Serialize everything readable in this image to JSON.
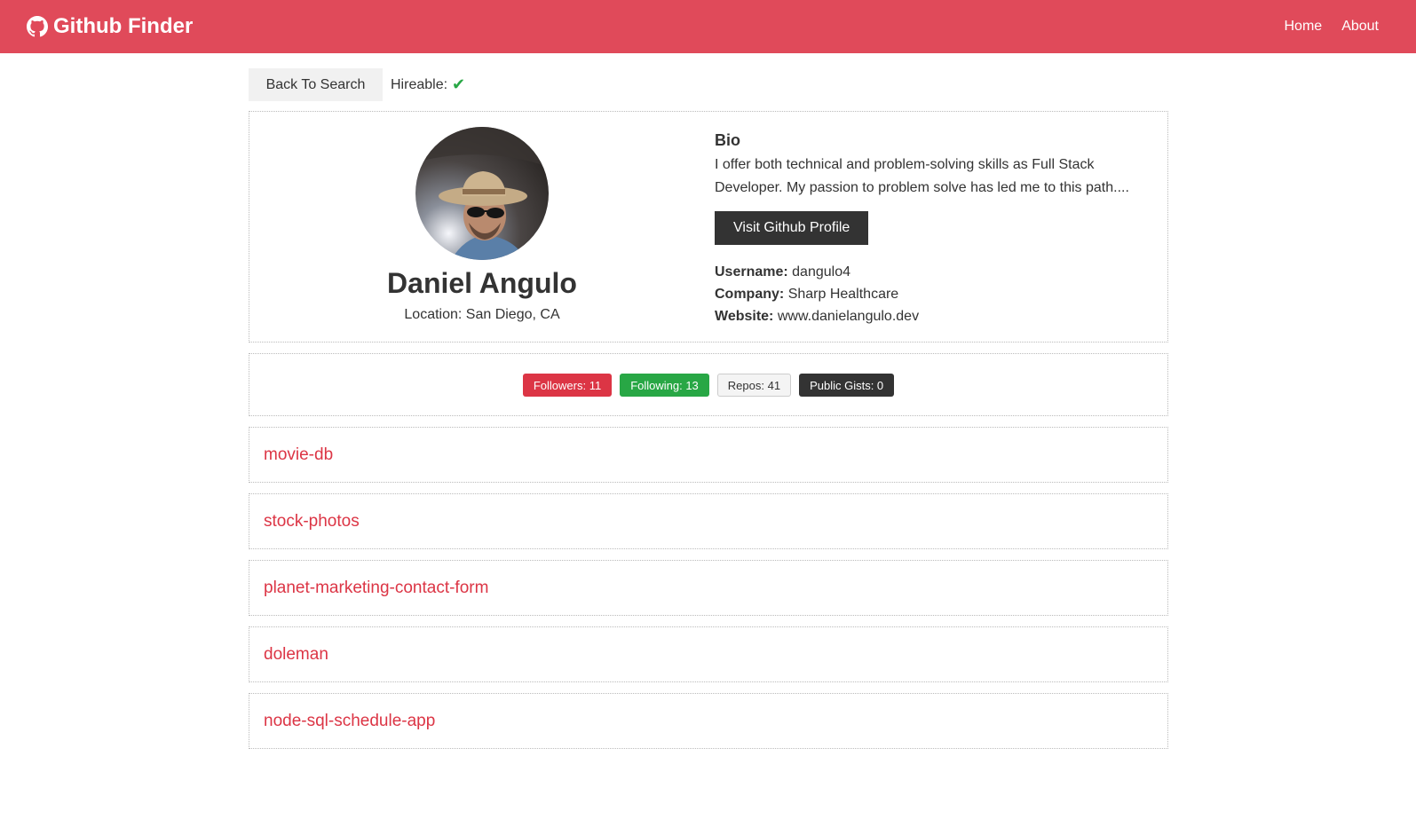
{
  "navbar": {
    "brand": "Github Finder",
    "brand_icon": "github-icon",
    "links": [
      "Home",
      "About"
    ],
    "color": "#e04a5a"
  },
  "topbar": {
    "back_label": "Back To Search",
    "hireable_label": "Hireable:",
    "hireable": true,
    "hireable_icon": "check-icon"
  },
  "profile": {
    "name": "Daniel Angulo",
    "location": "Location: San Diego, CA",
    "bio_heading": "Bio",
    "bio": "I offer both technical and problem-solving skills as Full Stack Developer. My passion to problem solve has led me to this path....",
    "visit_label": "Visit Github Profile",
    "username_label": "Username:",
    "username": "dangulo4",
    "company_label": "Company:",
    "company": "Sharp Healthcare",
    "website_label": "Website:",
    "website": "www.danielangulo.dev"
  },
  "stats": {
    "followers": "Followers: 11",
    "following": "Following: 13",
    "repos": "Repos: 41",
    "gists": "Public Gists: 0"
  },
  "repos": [
    "movie-db",
    "stock-photos",
    "planet-marketing-contact-form",
    "doleman",
    "node-sql-schedule-app"
  ],
  "colors": {
    "accent": "#dc3545",
    "success": "#28a745",
    "dark": "#333333"
  }
}
